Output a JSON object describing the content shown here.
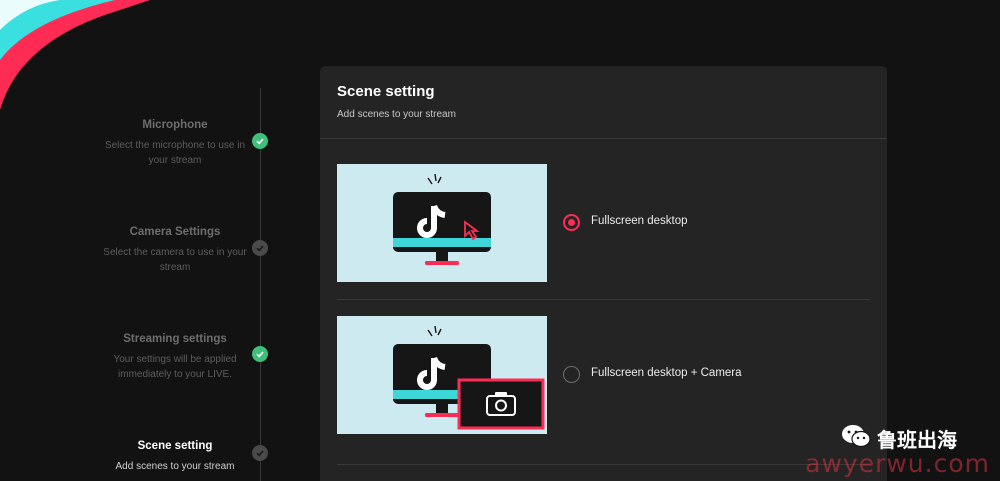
{
  "steps": [
    {
      "title": "Microphone",
      "desc": "Select the microphone to use in your stream",
      "status": "done"
    },
    {
      "title": "Camera Settings",
      "desc": "Select the camera to use in your stream",
      "status": "pending"
    },
    {
      "title": "Streaming settings",
      "desc": "Your settings will be applied immediately to your LIVE.",
      "status": "done"
    },
    {
      "title": "Scene setting",
      "desc": "Add scenes to your stream",
      "status": "pending"
    }
  ],
  "card": {
    "title": "Scene setting",
    "subtitle": "Add scenes to your stream",
    "options": [
      {
        "label": "Fullscreen desktop",
        "selected": true
      },
      {
        "label": "Fullscreen desktop + Camera",
        "selected": false
      }
    ]
  },
  "watermark": {
    "brand": "鲁班出海",
    "url": "awyerwu.com"
  },
  "colors": {
    "accent": "#fe2c55",
    "check": "#3fbf7a",
    "cyan": "#25f4ee"
  }
}
